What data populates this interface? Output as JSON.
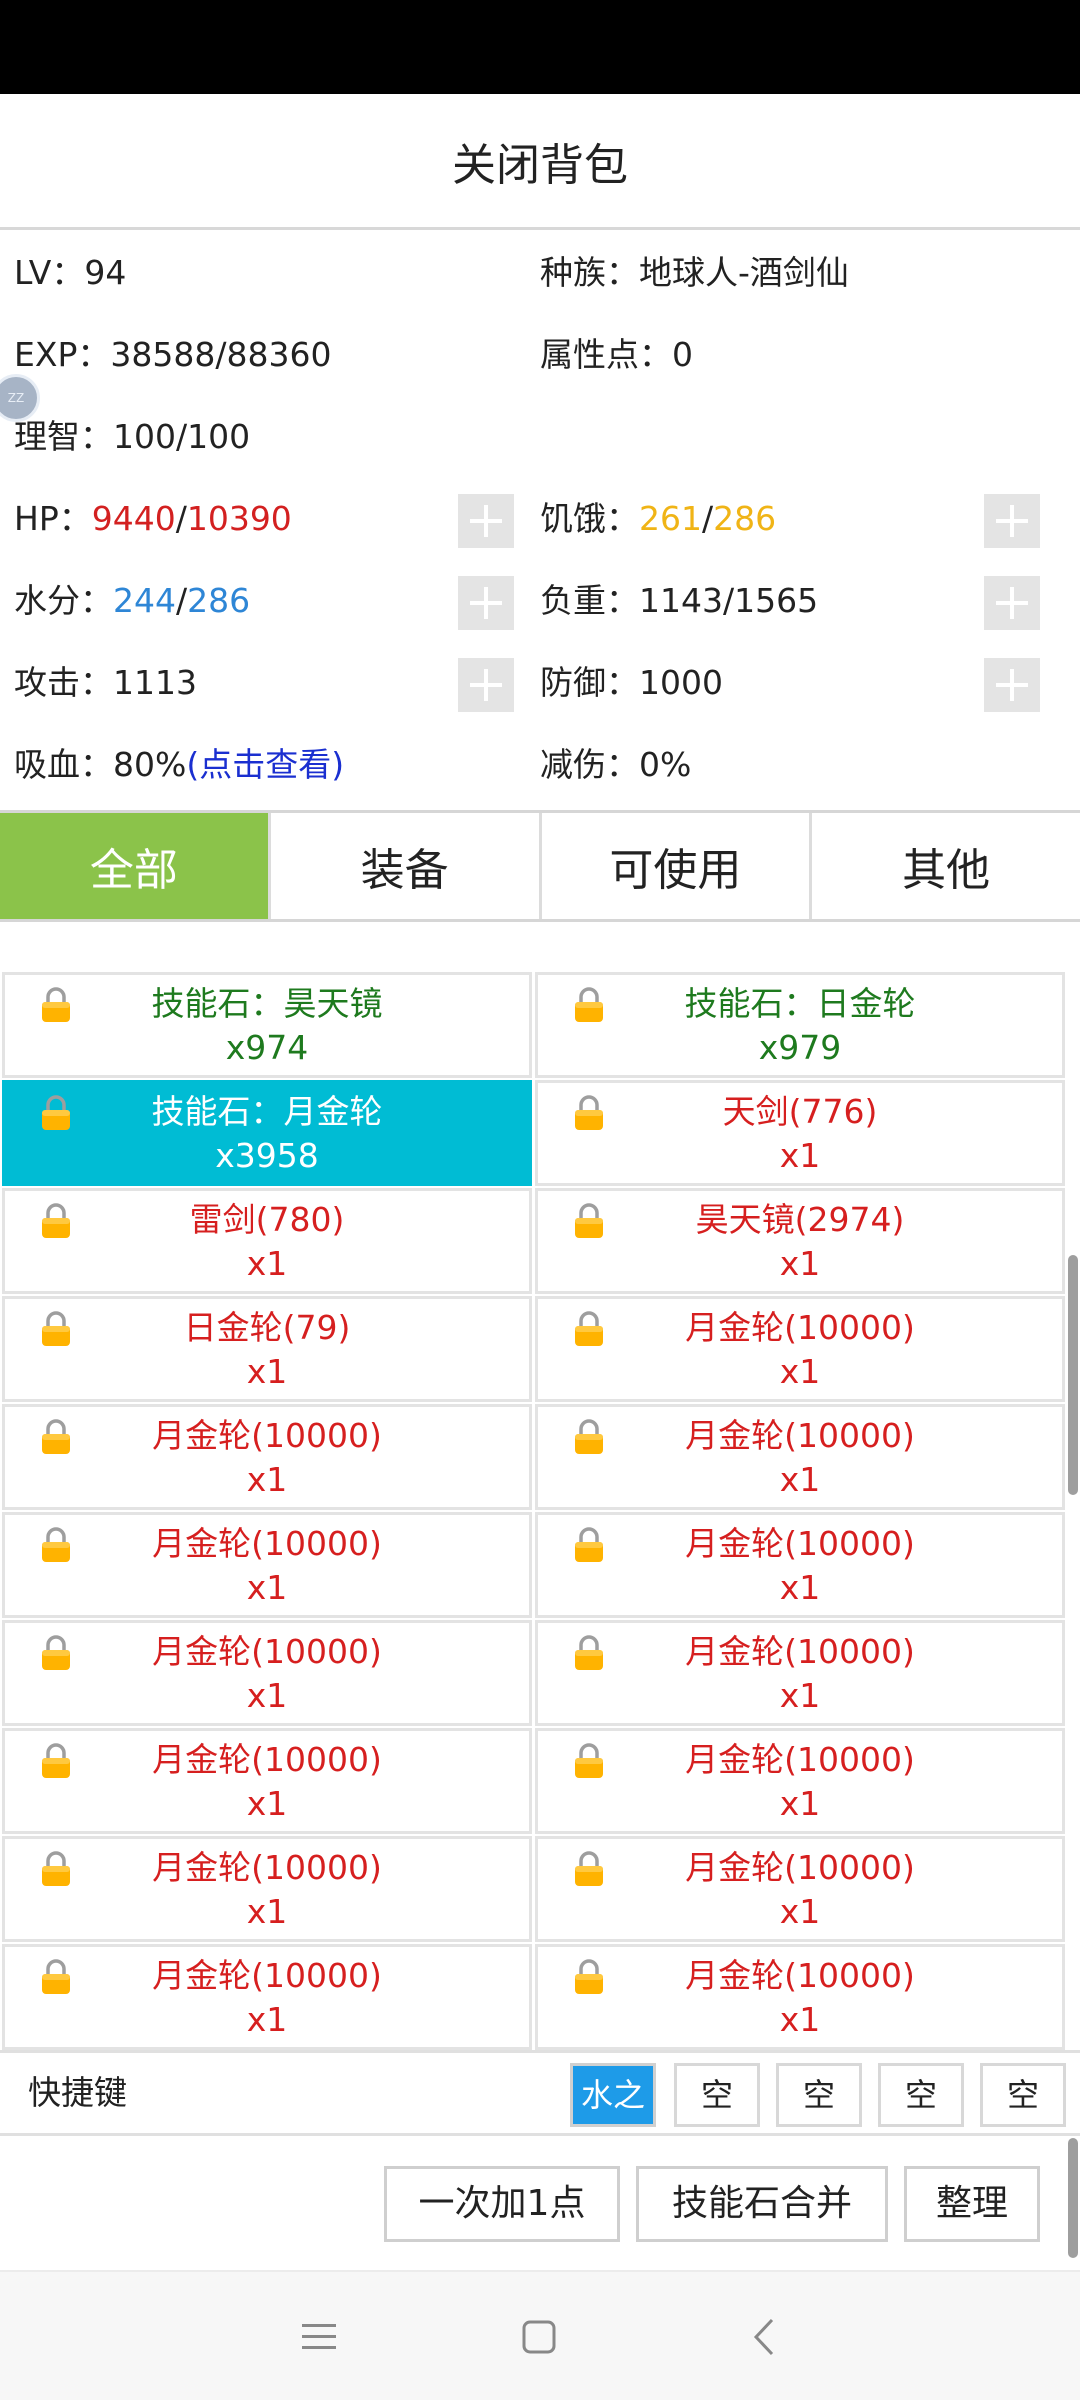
{
  "title": "关闭背包",
  "stats": {
    "lv_label": "LV：",
    "lv_value": "94",
    "race_label": "种族：",
    "race_value": "地球人-酒剑仙",
    "exp_label": "EXP：",
    "exp_value": "38588/88360",
    "attr_label": "属性点：",
    "attr_value": "0",
    "sanity_label": "理智：",
    "sanity_value": "100/100",
    "hp_label": "HP：",
    "hp_current": "9440",
    "hp_slash": "/",
    "hp_max": "10390",
    "hunger_label": "饥饿：",
    "hunger_current": "261",
    "hunger_slash": "/",
    "hunger_max": "286",
    "water_label": "水分：",
    "water_current": "244",
    "water_slash": "/",
    "water_max": "286",
    "load_label": "负重：",
    "load_value": "1143/1565",
    "attack_label": "攻击：",
    "attack_value": "1113",
    "defense_label": "防御：",
    "defense_value": "1000",
    "lifesteal_label": "吸血：",
    "lifesteal_value": "80%",
    "lifesteal_link": "(点击查看)",
    "reduction_label": "减伤：",
    "reduction_value": "0%",
    "avatar_text": "ZZ"
  },
  "tabs": [
    "全部",
    "装备",
    "可使用",
    "其他"
  ],
  "active_tab": "全部",
  "items": [
    {
      "name": "技能石：昊天镜",
      "count": "x974",
      "color": "green"
    },
    {
      "name": "技能石：日金轮",
      "count": "x979",
      "color": "green"
    },
    {
      "name": "技能石：月金轮",
      "count": "x3958",
      "color": "selected"
    },
    {
      "name": "天剑(776)",
      "count": "x1",
      "color": "red"
    },
    {
      "name": "雷剑(780)",
      "count": "x1",
      "color": "red"
    },
    {
      "name": "昊天镜(2974)",
      "count": "x1",
      "color": "red"
    },
    {
      "name": "日金轮(79)",
      "count": "x1",
      "color": "red"
    },
    {
      "name": "月金轮(10000)",
      "count": "x1",
      "color": "red"
    },
    {
      "name": "月金轮(10000)",
      "count": "x1",
      "color": "red"
    },
    {
      "name": "月金轮(10000)",
      "count": "x1",
      "color": "red"
    },
    {
      "name": "月金轮(10000)",
      "count": "x1",
      "color": "red"
    },
    {
      "name": "月金轮(10000)",
      "count": "x1",
      "color": "red"
    },
    {
      "name": "月金轮(10000)",
      "count": "x1",
      "color": "red"
    },
    {
      "name": "月金轮(10000)",
      "count": "x1",
      "color": "red"
    },
    {
      "name": "月金轮(10000)",
      "count": "x1",
      "color": "red"
    },
    {
      "name": "月金轮(10000)",
      "count": "x1",
      "color": "red"
    },
    {
      "name": "月金轮(10000)",
      "count": "x1",
      "color": "red"
    },
    {
      "name": "月金轮(10000)",
      "count": "x1",
      "color": "red"
    },
    {
      "name": "月金轮(10000)",
      "count": "x1",
      "color": "red"
    },
    {
      "name": "月金轮(10000)",
      "count": "x1",
      "color": "red"
    }
  ],
  "shortcut": {
    "label": "快捷键",
    "slots": [
      "水之",
      "空",
      "空",
      "空",
      "空"
    ]
  },
  "actions": {
    "add_one": "一次加1点",
    "merge_stones": "技能石合并",
    "sort": "整理"
  },
  "colors": {
    "tab_active": "#8bc34a",
    "selected_item": "#00bcd4",
    "item_green": "#1e7a1e",
    "item_red": "#d61f1f",
    "hp_red": "#d32020",
    "hunger_yellow": "#f0b416",
    "water_blue": "#2e86d6",
    "link_blue": "#1a2fd0",
    "shortcut_active": "#1e9be8"
  },
  "icons": {
    "lock": "padlock-icon",
    "nav": [
      "menu-icon",
      "home-square-icon",
      "back-chevron-icon"
    ]
  }
}
